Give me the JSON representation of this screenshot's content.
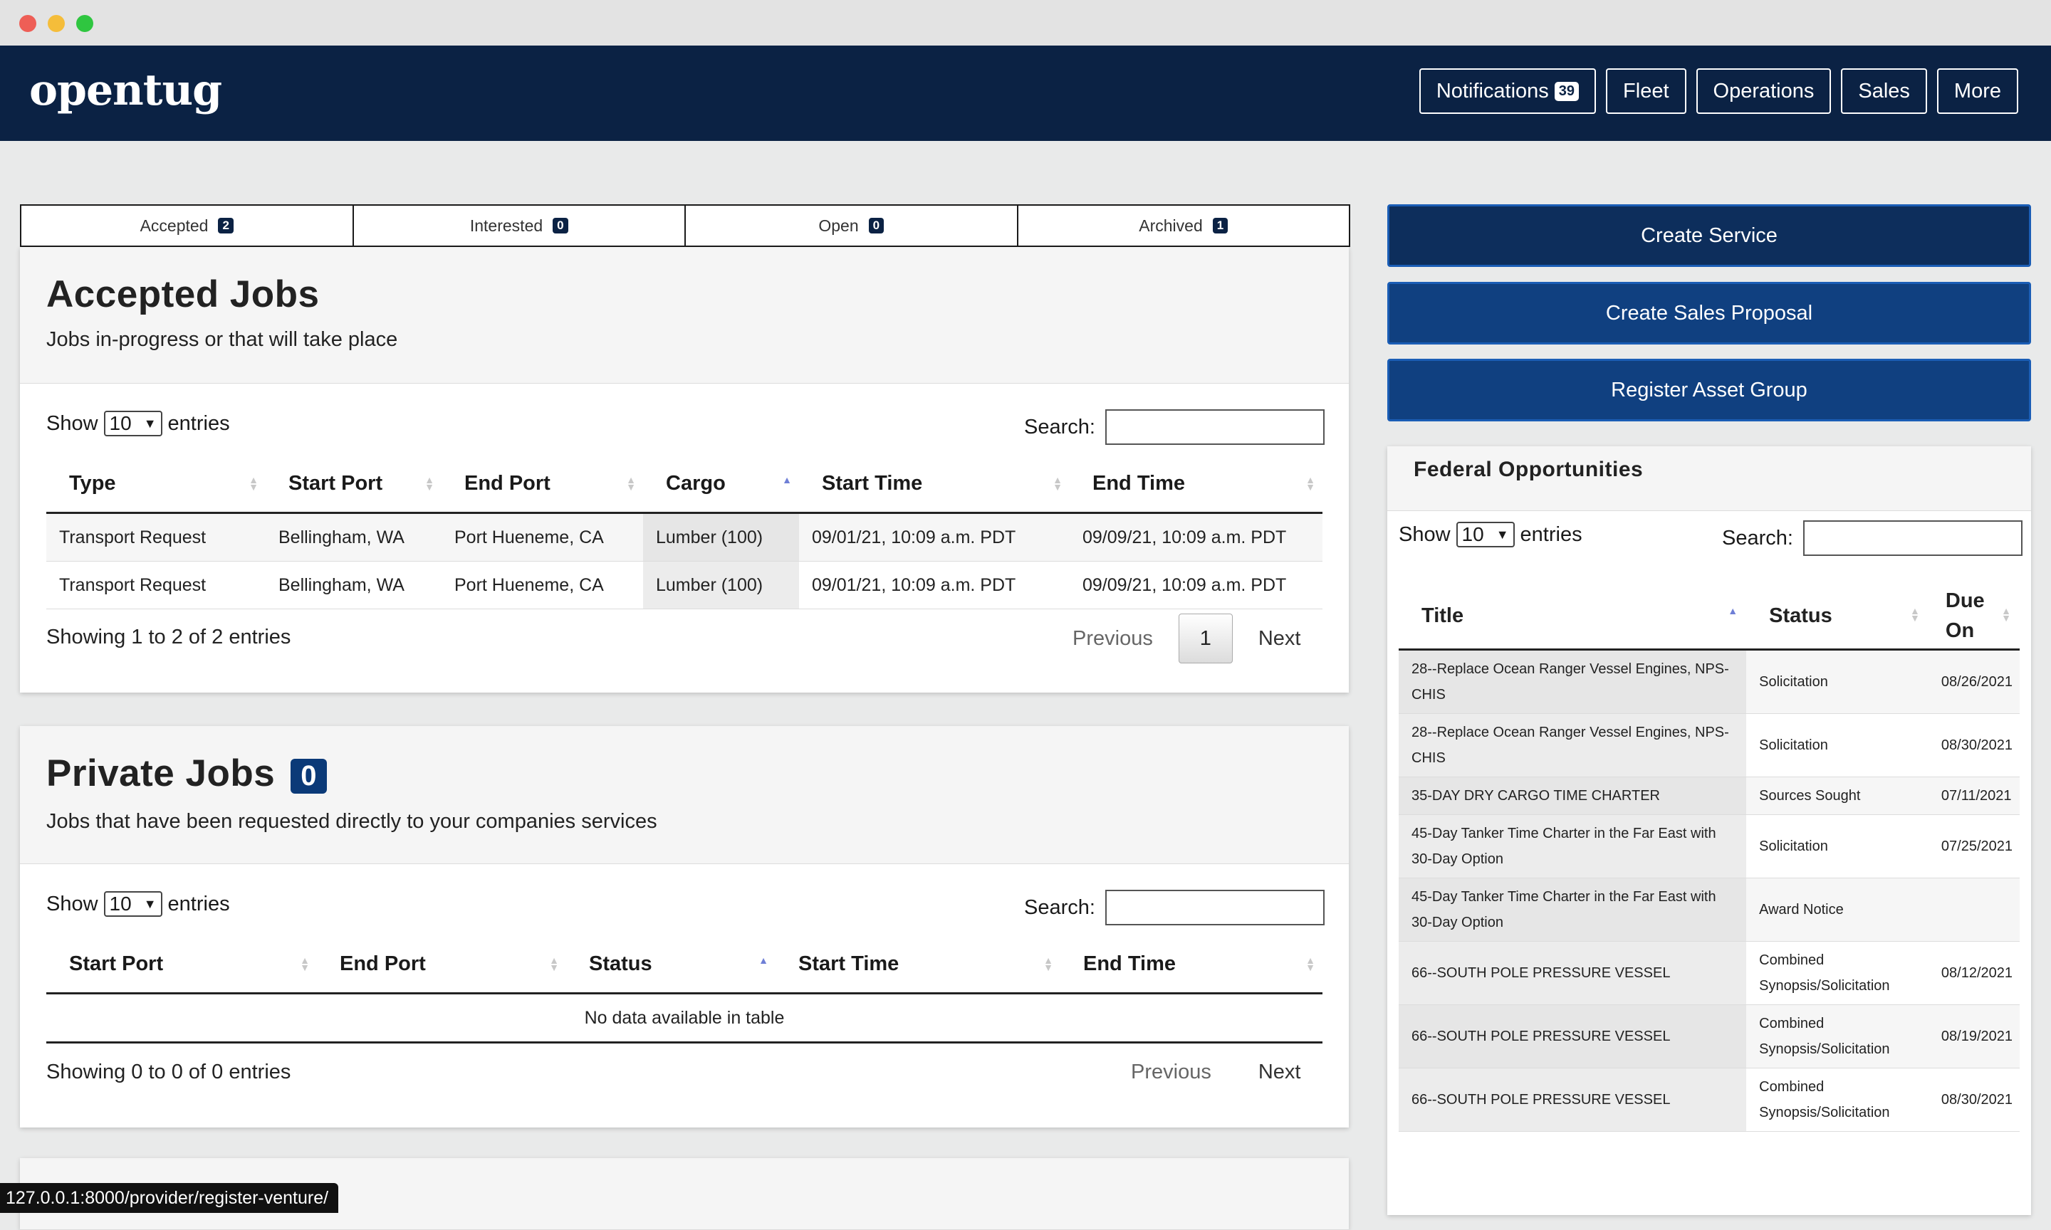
{
  "app": {
    "brand": "opentug"
  },
  "nav": {
    "notifications": {
      "label": "Notifications",
      "count": "39"
    },
    "fleet": "Fleet",
    "operations": "Operations",
    "sales": "Sales",
    "more": "More"
  },
  "tabs": [
    {
      "label": "Accepted",
      "count": "2"
    },
    {
      "label": "Interested",
      "count": "0"
    },
    {
      "label": "Open",
      "count": "0"
    },
    {
      "label": "Archived",
      "count": "1"
    }
  ],
  "accepted": {
    "title": "Accepted Jobs",
    "subtitle": "Jobs in-progress or that will take place",
    "show_label": "Show",
    "show_value": "10",
    "entries_label": "entries",
    "search_label": "Search:",
    "columns": [
      "Type",
      "Start Port",
      "End Port",
      "Cargo",
      "Start Time",
      "End Time"
    ],
    "rows": [
      [
        "Transport Request",
        "Bellingham, WA",
        "Port Hueneme, CA",
        "Lumber (100)",
        "09/01/21, 10:09 a.m. PDT",
        "09/09/21, 10:09 a.m. PDT"
      ],
      [
        "Transport Request",
        "Bellingham, WA",
        "Port Hueneme, CA",
        "Lumber (100)",
        "09/01/21, 10:09 a.m. PDT",
        "09/09/21, 10:09 a.m. PDT"
      ]
    ],
    "info": "Showing 1 to 2 of 2 entries",
    "previous": "Previous",
    "page": "1",
    "next": "Next"
  },
  "private": {
    "title": "Private Jobs",
    "count": "0",
    "subtitle": "Jobs that have been requested directly to your companies services",
    "show_label": "Show",
    "show_value": "10",
    "entries_label": "entries",
    "search_label": "Search:",
    "columns": [
      "Start Port",
      "End Port",
      "Status",
      "Start Time",
      "End Time"
    ],
    "empty": "No data available in table",
    "info": "Showing 0 to 0 of 0 entries",
    "previous": "Previous",
    "next": "Next"
  },
  "actions": {
    "create_service": "Create Service",
    "create_sales_proposal": "Create Sales Proposal",
    "register_asset_group": "Register Asset Group"
  },
  "federal": {
    "title": "Federal Opportunities",
    "show_label": "Show",
    "show_value": "10",
    "entries_label": "entries",
    "search_label": "Search:",
    "columns": [
      "Title",
      "Status",
      "Due On"
    ],
    "rows": [
      [
        "28--Replace Ocean Ranger Vessel Engines, NPS-CHIS",
        "Solicitation",
        "08/26/2021"
      ],
      [
        "28--Replace Ocean Ranger Vessel Engines, NPS-CHIS",
        "Solicitation",
        "08/30/2021"
      ],
      [
        "35-DAY DRY CARGO TIME CHARTER",
        "Sources Sought",
        "07/11/2021"
      ],
      [
        "45-Day Tanker Time Charter in the Far East with 30-Day Option",
        "Solicitation",
        "07/25/2021"
      ],
      [
        "45-Day Tanker Time Charter in the Far East with 30-Day Option",
        "Award Notice",
        ""
      ],
      [
        "66--SOUTH POLE PRESSURE VESSEL",
        "Combined Synopsis/Solicitation",
        "08/12/2021"
      ],
      [
        "66--SOUTH POLE PRESSURE VESSEL",
        "Combined Synopsis/Solicitation",
        "08/19/2021"
      ],
      [
        "66--SOUTH POLE PRESSURE VESSEL",
        "Combined Synopsis/Solicitation",
        "08/30/2021"
      ]
    ]
  },
  "statusbar": {
    "url": "127.0.0.1:8000/provider/register-venture/"
  }
}
